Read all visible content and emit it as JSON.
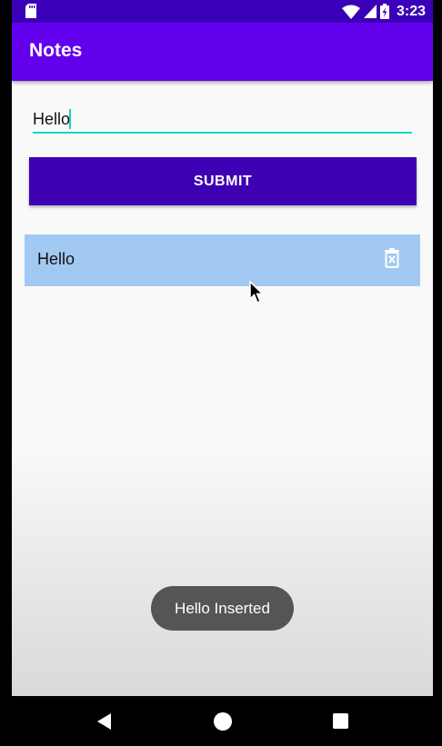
{
  "status_bar": {
    "time": "3:23"
  },
  "app_bar": {
    "title": "Notes"
  },
  "form": {
    "input_value": "Hello",
    "submit_label": "SUBMIT"
  },
  "notes": [
    {
      "text": "Hello"
    }
  ],
  "toast": {
    "text": "Hello Inserted"
  },
  "icons": {
    "sd_card": "sd-card-icon",
    "wifi": "wifi-icon",
    "signal": "signal-icon",
    "battery": "battery-icon",
    "delete": "delete-icon",
    "cursor": "mouse-cursor-icon",
    "back": "back-icon",
    "home": "home-icon",
    "recents": "recents-icon"
  },
  "colors": {
    "status_bar": "#3a00b8",
    "app_bar": "#6200ee",
    "button": "#3d00b3",
    "input_underline": "#1ad3c4",
    "note_background": "#a2c9f1",
    "toast_background": "#555555"
  }
}
